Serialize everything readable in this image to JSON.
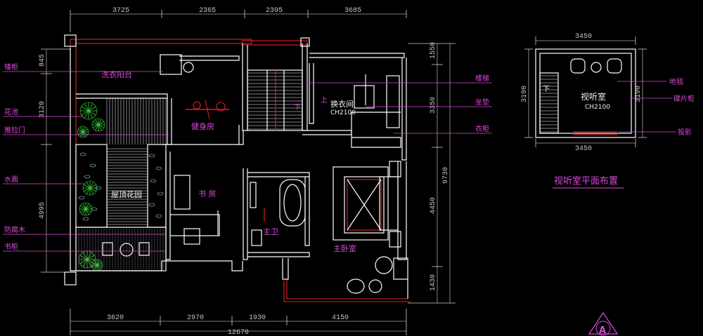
{
  "top_dims": [
    "3725",
    "2365",
    "2395",
    "3685"
  ],
  "bottom_dims": [
    "3620",
    "2970",
    "1930",
    "4150"
  ],
  "bottom_total": "12670",
  "left_dims": [
    "845",
    "3120",
    "4995"
  ],
  "right_dims": [
    "1550",
    "3350",
    "9730",
    "4450",
    "1430"
  ],
  "rooms": {
    "laundry_balcony": "洗衣阳台",
    "gym": "健身房",
    "roof_garden": "屋顶花园",
    "study": "书  房",
    "dressing_room": "换衣间",
    "dressing_code": "CH2100",
    "master_bath": "主卫",
    "master_bedroom": "主卧室"
  },
  "stair_marks": {
    "down": "下",
    "up": "上"
  },
  "left_labels": [
    "矮柜",
    "花池",
    "推拉门",
    "水面",
    "防腐木",
    "书柜"
  ],
  "right_labels": [
    "楼梯",
    "坐垫",
    "衣柜"
  ],
  "media_room": {
    "title": "视听室平面布置",
    "room_name": "视听室",
    "room_code": "CH2100",
    "dim_top": "3450",
    "dim_bottom": "3450",
    "dim_left": "3190",
    "dim_right": "3190",
    "stair_mark": "下",
    "labels": [
      "地毯",
      "碟片柜",
      "投影"
    ]
  },
  "section_mark": "A"
}
